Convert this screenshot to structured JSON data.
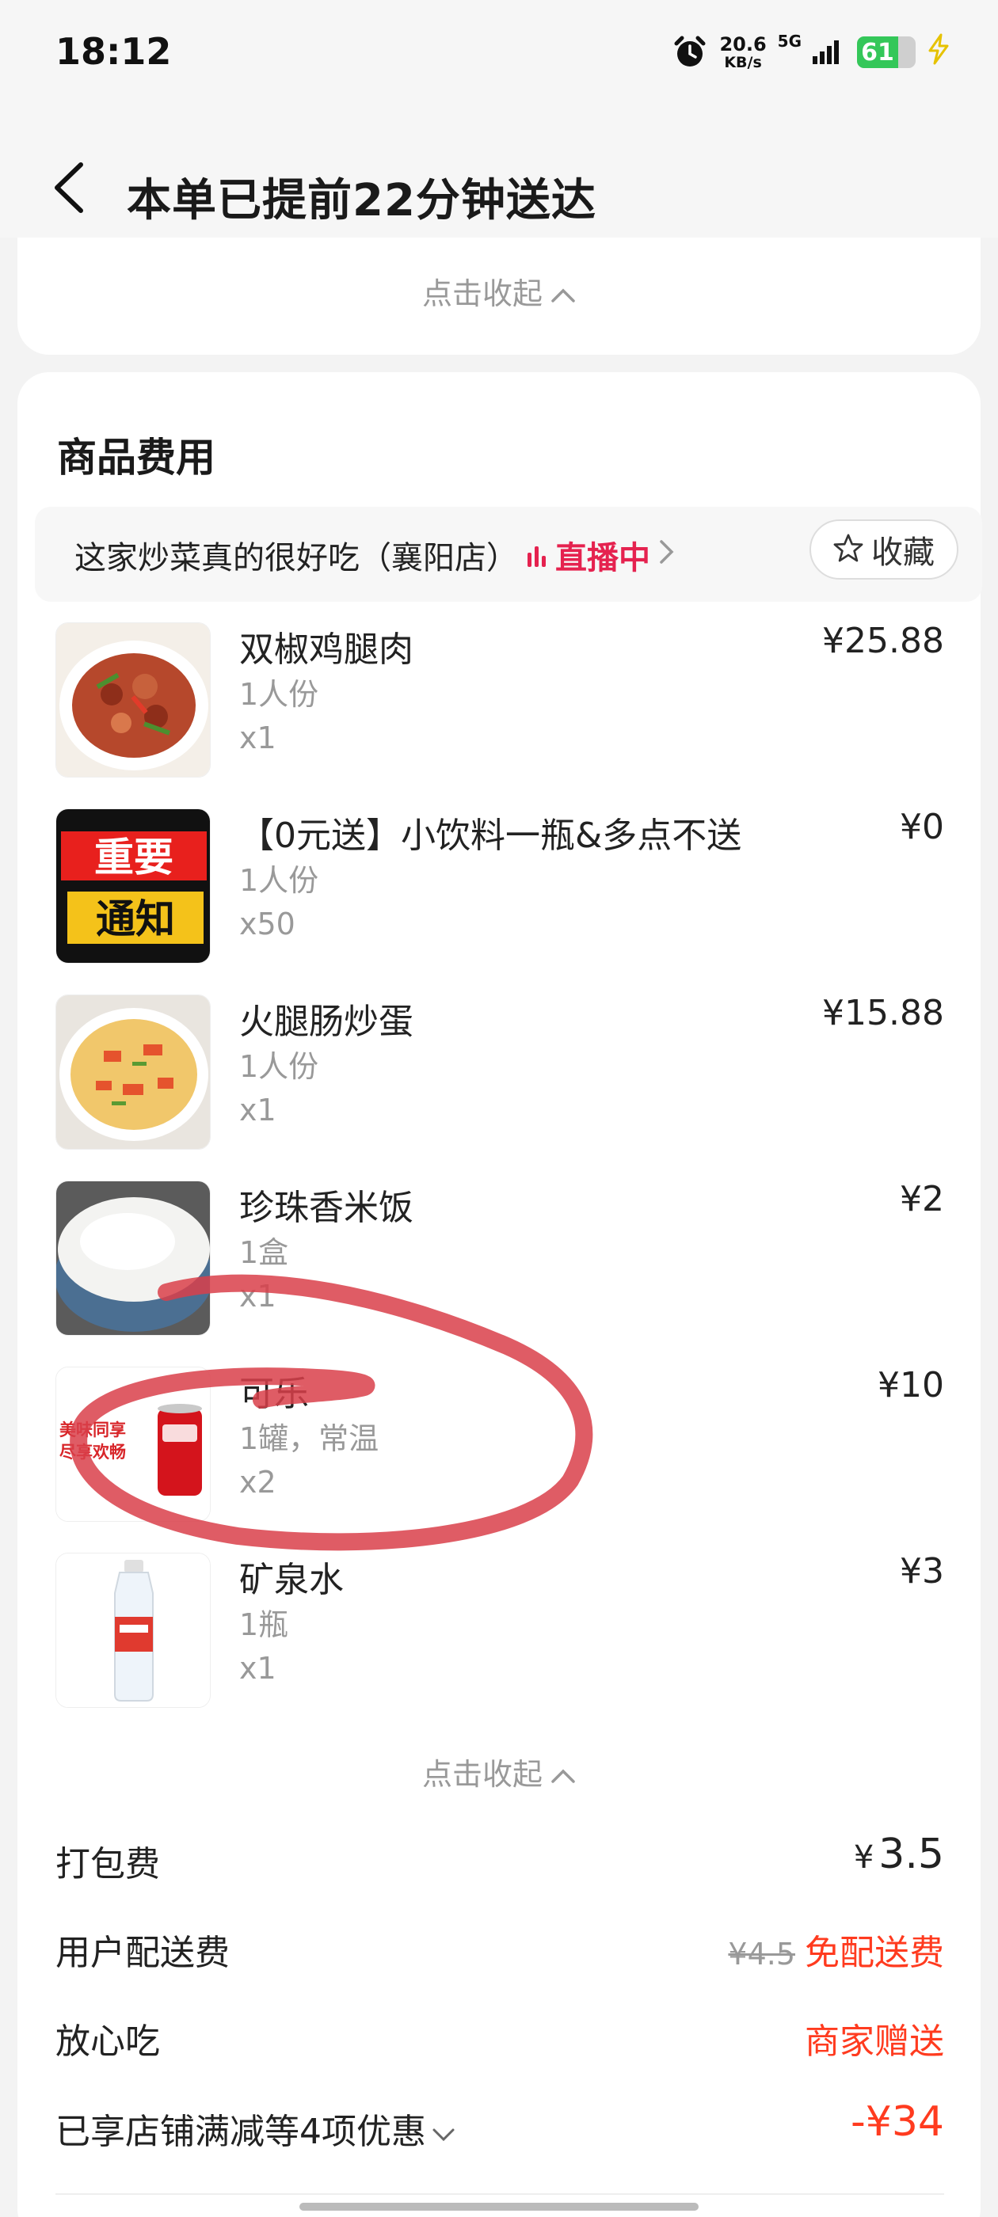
{
  "status_bar": {
    "time": "18:12",
    "net_speed": "20.6",
    "net_unit": "KB/s",
    "net_type": "5G",
    "battery": "61",
    "icons": [
      "alarm-icon",
      "signal-icon",
      "battery-icon",
      "charging-icon"
    ]
  },
  "header": {
    "title": "本单已提前22分钟送达",
    "back_icon": "back-arrow-icon"
  },
  "top_card": {
    "collapse_label": "点击收起"
  },
  "goods_section": {
    "title": "商品费用",
    "store": {
      "name": "这家炒菜真的很好吃（襄阳店）",
      "live_label": "直播中",
      "favorite_label": "收藏"
    },
    "items": [
      {
        "name": "双椒鸡腿肉",
        "spec": "1人份",
        "qty": "x1",
        "price": "¥25.88"
      },
      {
        "name": "【0元送】小饮料一瓶&多点不送",
        "spec": "1人份",
        "qty": "x50",
        "price": "¥0"
      },
      {
        "name": "火腿肠炒蛋",
        "spec": "1人份",
        "qty": "x1",
        "price": "¥15.88"
      },
      {
        "name": "珍珠香米饭",
        "spec": "1盒",
        "qty": "x1",
        "price": "¥2"
      },
      {
        "name": "可乐",
        "spec": "1罐，常温",
        "qty": "x2",
        "price": "¥10"
      },
      {
        "name": "矿泉水",
        "spec": "1瓶",
        "qty": "x1",
        "price": "¥3"
      }
    ],
    "thumb_texts": {
      "poster_line1": "重要",
      "poster_line2": "通知",
      "cola_promo_line1": "美味同享",
      "cola_promo_line2": "尽享欢畅"
    },
    "collapse_label": "点击收起"
  },
  "fees": {
    "packing": {
      "label": "打包费",
      "currency": "¥",
      "value": "3.5"
    },
    "delivery": {
      "label": "用户配送费",
      "original": "¥4.5",
      "value": "免配送费"
    },
    "safe_eat": {
      "label": "放心吃",
      "value": "商家赠送"
    },
    "discount": {
      "label": "已享店铺满减等4项优惠",
      "value": "-¥34"
    }
  },
  "colors": {
    "accent_red": "#ff3b1f",
    "live_pink": "#e5224f",
    "annotation_red": "#d9404a"
  }
}
